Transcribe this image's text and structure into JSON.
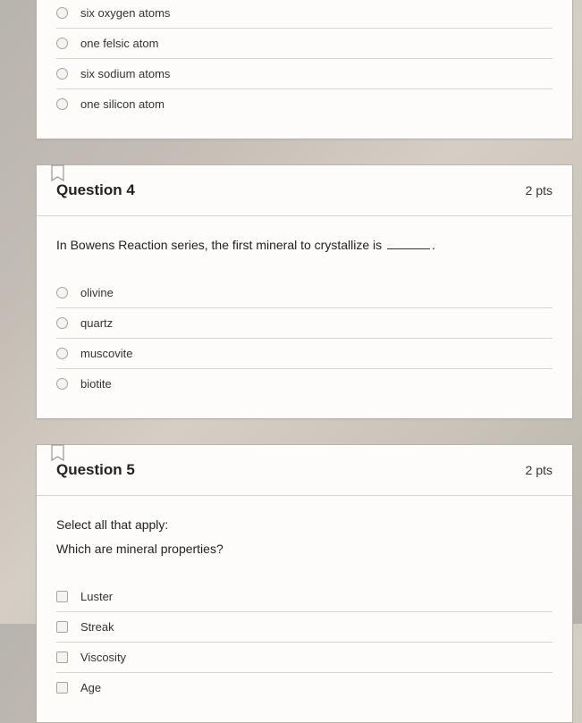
{
  "q3": {
    "options": [
      "six oxygen atoms",
      "one felsic atom",
      "six sodium atoms",
      "one silicon atom"
    ]
  },
  "q4": {
    "title": "Question 4",
    "pts": "2 pts",
    "prompt_pre": "In Bowens Reaction series, the first mineral to crystallize is ",
    "prompt_post": ".",
    "options": [
      "olivine",
      "quartz",
      "muscovite",
      "biotite"
    ]
  },
  "q5": {
    "title": "Question 5",
    "pts": "2 pts",
    "prompt_line1": "Select all that apply:",
    "prompt_line2": "Which are mineral properties?",
    "options": [
      "Luster",
      "Streak",
      "Viscosity",
      "Age"
    ]
  }
}
